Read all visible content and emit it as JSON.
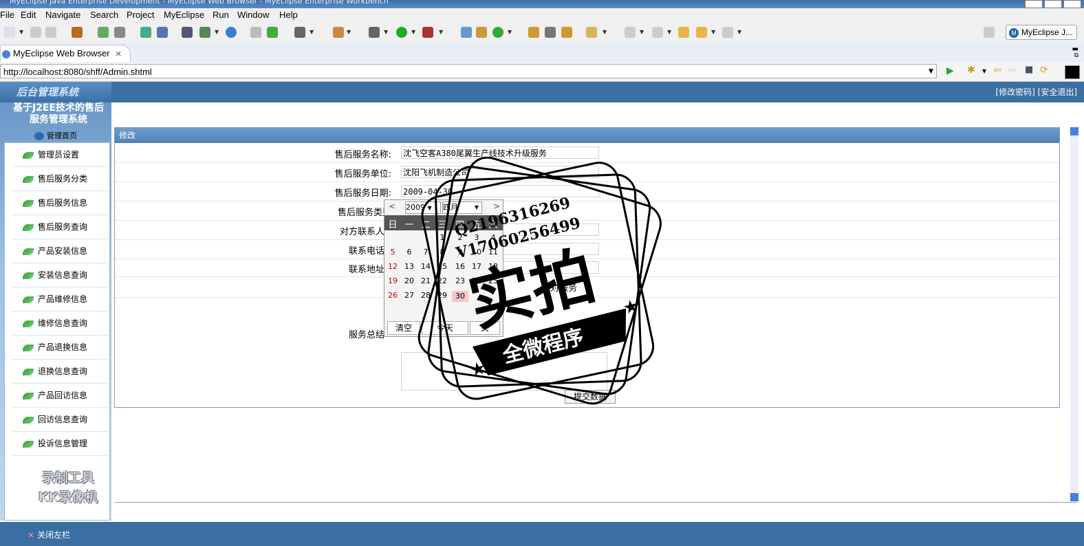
{
  "window": {
    "title": "MyEclipse Java Enterprise Development - MyEclipse Web Browser - MyEclipse Enterprise Workbench"
  },
  "menubar": [
    "File",
    "Edit",
    "Navigate",
    "Search",
    "Project",
    "MyEclipse",
    "Run",
    "Window",
    "Help"
  ],
  "perspective": {
    "label": "MyEclipse J..."
  },
  "editor_tab": {
    "label": "MyEclipse Web Browser"
  },
  "browser": {
    "url": "http://localhost:8080/shff/Admin.shtml"
  },
  "site": {
    "header_logo": "后台管理系统",
    "header_links": "[修改密码] [安全退出]",
    "system_title_line1": "基于J2EE技术的售后",
    "system_title_line2": "服务管理系统",
    "home_label": "管理首页",
    "nav": [
      "管理员设置",
      "售后服务分类",
      "售后服务信息",
      "售后服务查询",
      "产品安装信息",
      "安装信息查询",
      "产品维修信息",
      "维修信息查询",
      "产品退换信息",
      "退换信息查询",
      "产品回访信息",
      "回访信息查询",
      "投诉信息管理"
    ],
    "footer_label": "关闭左栏",
    "footer_icon": "×"
  },
  "form": {
    "section_title": "修改",
    "labels": [
      "售后服务名称:",
      "售后服务单位:",
      "售后服务日期:",
      "售后服务类型",
      "对方联系人",
      "联系电话",
      "联系地址",
      "服务总结"
    ],
    "name_value": "沈飞空客A380尾翼生产线技术升级服务",
    "unit_value": "沈阳飞机制造公司",
    "date_value": "2009-04-30",
    "partial_text": "面对服务",
    "submit_label": "提交数据"
  },
  "calendar": {
    "year": "2009",
    "month": "四月",
    "prev": "<",
    "next": ">",
    "weekdays": [
      "日",
      "一",
      "二",
      "三",
      "四",
      "五",
      "六"
    ],
    "weeks": [
      [
        "",
        "",
        "",
        "1",
        "2",
        "3",
        "4"
      ],
      [
        "5",
        "6",
        "7",
        "8",
        "9",
        "10",
        "11"
      ],
      [
        "12",
        "13",
        "14",
        "15",
        "16",
        "17",
        "18"
      ],
      [
        "19",
        "20",
        "21",
        "22",
        "23",
        "24",
        "25"
      ],
      [
        "26",
        "27",
        "28",
        "29",
        "30",
        "",
        ""
      ]
    ],
    "selected": "30",
    "clear_label": "清空",
    "today_label": "今天",
    "close_label": "关"
  },
  "watermarks": {
    "recorder_line1": "录制工具",
    "recorder_line2": "KK录像机",
    "stamp_q": "Q2196316269",
    "stamp_v": "V17060256499",
    "stamp_main": "实拍",
    "stamp_banner": "全微程序"
  }
}
